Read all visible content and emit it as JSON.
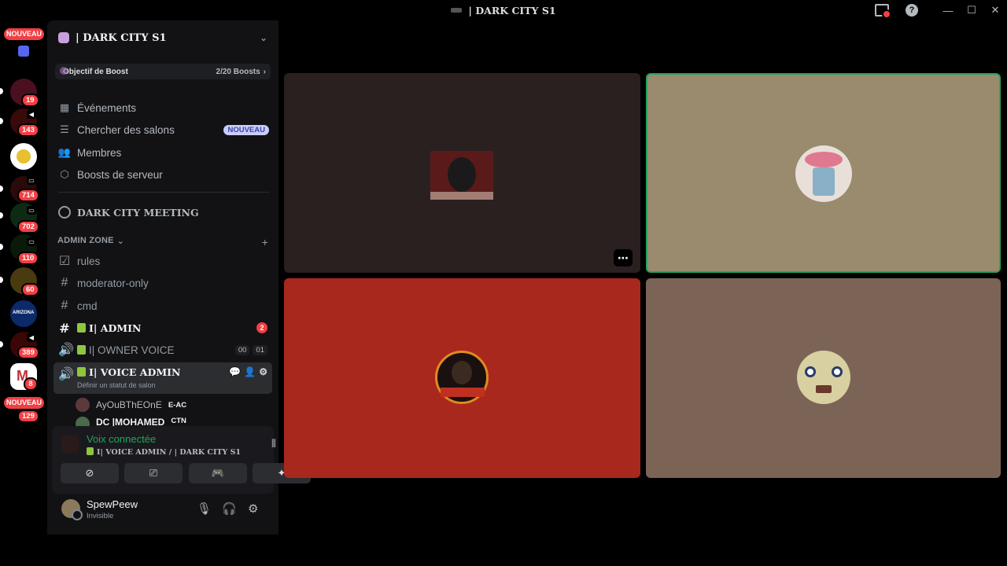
{
  "window": {
    "title": "| DARK CITY S1"
  },
  "rail": {
    "badges": [
      "19",
      "143",
      "714",
      "702",
      "110",
      "60",
      "389",
      "8",
      "129"
    ],
    "new_label_top": "NOUVEAU",
    "new_label_bottom": "NOUVEAU"
  },
  "guild": {
    "name": "| DARK CITY S1",
    "boost_label": "Objectif de Boost",
    "boost_value": "2/20 Boosts"
  },
  "nav": {
    "events": "Événements",
    "browse": "Chercher des salons",
    "browse_tag": "NOUVEAU",
    "members": "Membres",
    "boosts": "Boosts de serveur"
  },
  "meeting": "DARK CITY MEETING",
  "category": {
    "label": "ADMIN ZONE"
  },
  "channels": {
    "rules": "rules",
    "moderator": "moderator-only",
    "cmd": "cmd",
    "admin": "I| ADMIN",
    "admin_badge": "2",
    "owner_voice": "I| OWNER VOICE",
    "owner_voice_count_a": "00",
    "owner_voice_count_b": "01",
    "voice_admin": "I| VOICE ADMIN",
    "voice_admin_status": "Définir un statut de salon"
  },
  "voice_users": [
    {
      "name": "AyOuBThEOnE",
      "tag": "E-AC"
    },
    {
      "name": "DC |MOHAMED",
      "tag": "CTN"
    }
  ],
  "voice_panel": {
    "title": "Voix connectée",
    "subtitle": "I| VOICE ADMIN / | DARK CITY S1"
  },
  "user": {
    "name": "SpewPeew",
    "status": "Invisible"
  },
  "colors": {
    "tile1": "#2b2020",
    "tile2": "#9a8a6e",
    "tile3": "#a8281e",
    "tile4": "#7b6456",
    "speaking": "#23a55a",
    "accent_red": "#f23f43"
  }
}
